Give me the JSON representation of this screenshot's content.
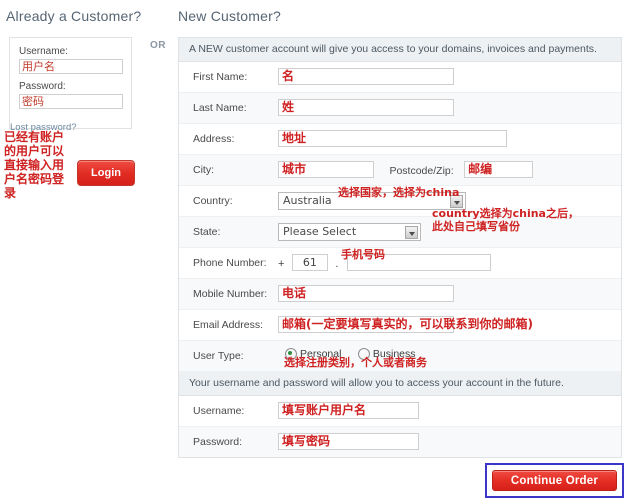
{
  "existing_customer": {
    "heading": "Already a Customer?",
    "username_label": "Username:",
    "username_value": "用户名",
    "password_label": "Password:",
    "password_value": "密码",
    "lost_password_link": "Lost password?",
    "login_button": "Login",
    "annotation": "已经有账户的用户可以直接输入用户名密码登录"
  },
  "divider": {
    "or": "OR"
  },
  "new_customer": {
    "heading": "New Customer?",
    "intro_band": "A NEW customer account will give you access to your domains, invoices and payments.",
    "credentials_band": "Your username and password will allow you to access your account in the future.",
    "rows": {
      "first_name": {
        "label": "First Name:",
        "value": "名"
      },
      "last_name": {
        "label": "Last Name:",
        "value": "姓"
      },
      "address": {
        "label": "Address:",
        "value": "地址"
      },
      "city": {
        "label": "City:",
        "value": "城市"
      },
      "postcode": {
        "label": "Postcode/Zip:",
        "value": "邮编"
      },
      "country": {
        "label": "Country:",
        "value": "Australia"
      },
      "state": {
        "label": "State:",
        "value": "Please Select"
      },
      "phone": {
        "label": "Phone Number:",
        "prefix_symbol": "+",
        "country_code": "61",
        "separator": ".",
        "value": "手机号码"
      },
      "mobile": {
        "label": "Mobile Number:",
        "value": "电话"
      },
      "email": {
        "label": "Email Address:",
        "value": "邮箱(一定要填写真实的，可以联系到你的邮箱)"
      },
      "user_type": {
        "label": "User Type:",
        "options": [
          {
            "label": "Personal",
            "selected": true
          },
          {
            "label": "Business",
            "selected": false
          }
        ]
      },
      "username": {
        "label": "Username:",
        "value": "填写账户用户名"
      },
      "password": {
        "label": "Password:",
        "value": "填写密码"
      }
    },
    "annotations": {
      "country": "选择国家，选择为china",
      "state": "country选择为china之后，\n此处自己填写省份",
      "phone": "手机号码",
      "user_type": "选择注册类别，个人或者商务"
    },
    "continue_button": "Continue Order"
  },
  "colors": {
    "annotation_red": "#cf2222",
    "button_red": "#e42e24",
    "focus_outline_blue": "#3b36c8",
    "heading_slate": "#566573",
    "band_gray": "#eef1f4"
  }
}
